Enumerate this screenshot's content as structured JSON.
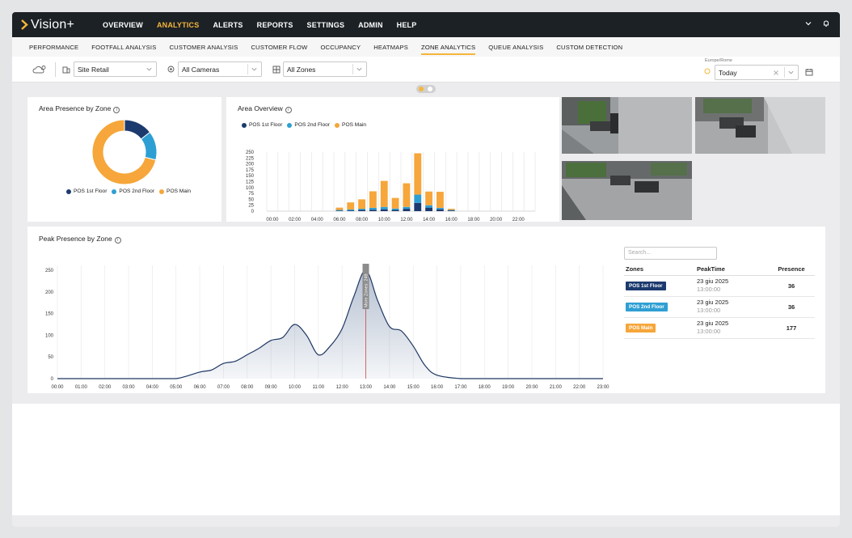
{
  "app": {
    "logo_text": "Vision+"
  },
  "main_nav": [
    {
      "label": "OVERVIEW"
    },
    {
      "label": "ANALYTICS",
      "active": true
    },
    {
      "label": "ALERTS"
    },
    {
      "label": "REPORTS"
    },
    {
      "label": "SETTINGS"
    },
    {
      "label": "ADMIN"
    },
    {
      "label": "HELP"
    }
  ],
  "sub_nav": [
    {
      "label": "PERFORMANCE"
    },
    {
      "label": "FOOTFALL ANALYSIS"
    },
    {
      "label": "CUSTOMER ANALYSIS"
    },
    {
      "label": "CUSTOMER FLOW"
    },
    {
      "label": "OCCUPANCY"
    },
    {
      "label": "HEATMAPS"
    },
    {
      "label": "ZONE ANALYTICS",
      "active": true
    },
    {
      "label": "QUEUE ANALYSIS"
    },
    {
      "label": "CUSTOM DETECTION"
    }
  ],
  "filters": {
    "site": "Site Retail",
    "cameras": "All Cameras",
    "zones": "All Zones",
    "timezone": "Europe/Rome",
    "period": "Today"
  },
  "colors": {
    "accent": "#f5b63b",
    "pos1": "#1c3a6e",
    "pos2": "#2e9fd3",
    "posmain": "#f6a63a"
  },
  "area_presence": {
    "title": "Area Presence by Zone",
    "chart_data": {
      "type": "pie",
      "labels": [
        "POS 1st Floor",
        "POS 2nd Floor",
        "POS Main"
      ],
      "values": [
        36,
        36,
        177
      ]
    }
  },
  "area_overview": {
    "title": "Area Overview",
    "chart_data": {
      "type": "bar",
      "stacked": true,
      "x": [
        "00:00",
        "01:00",
        "02:00",
        "03:00",
        "04:00",
        "05:00",
        "06:00",
        "07:00",
        "08:00",
        "09:00",
        "10:00",
        "11:00",
        "12:00",
        "13:00",
        "14:00",
        "15:00",
        "16:00",
        "17:00",
        "18:00",
        "19:00",
        "20:00",
        "21:00",
        "22:00",
        "23:00"
      ],
      "tick_labels": [
        "00:00",
        "02:00",
        "04:00",
        "06:00",
        "08:00",
        "10:00",
        "12:00",
        "14:00",
        "16:00",
        "18:00",
        "20:00",
        "22:00"
      ],
      "series": [
        {
          "name": "POS 1st Floor",
          "values": [
            0,
            0,
            0,
            0,
            0,
            0,
            2,
            3,
            5,
            6,
            8,
            5,
            10,
            35,
            15,
            8,
            3,
            0,
            0,
            0,
            0,
            0,
            0,
            0
          ]
        },
        {
          "name": "POS 2nd Floor",
          "values": [
            0,
            0,
            0,
            0,
            0,
            0,
            3,
            4,
            5,
            8,
            10,
            6,
            8,
            35,
            10,
            6,
            2,
            0,
            0,
            0,
            0,
            0,
            0,
            0
          ]
        },
        {
          "name": "POS Main",
          "values": [
            0,
            0,
            0,
            0,
            0,
            0,
            10,
            30,
            40,
            70,
            110,
            45,
            100,
            175,
            58,
            68,
            5,
            0,
            0,
            0,
            0,
            0,
            0,
            0
          ]
        }
      ],
      "yticks": [
        0,
        25,
        50,
        75,
        100,
        125,
        150,
        175,
        200,
        225,
        250
      ],
      "ylim": [
        0,
        250
      ]
    }
  },
  "peak_presence": {
    "title": "Peak Presence by Zone",
    "marker_label": "More Zones: 249",
    "chart_data": {
      "type": "area",
      "x": [
        "00:00",
        "01:00",
        "02:00",
        "03:00",
        "04:00",
        "05:00",
        "06:00",
        "06:30",
        "07:00",
        "07:30",
        "08:00",
        "08:30",
        "09:00",
        "09:30",
        "10:00",
        "10:30",
        "11:00",
        "11:30",
        "12:00",
        "12:30",
        "13:00",
        "13:30",
        "14:00",
        "14:30",
        "15:00",
        "15:30",
        "16:00",
        "17:00",
        "18:00",
        "19:00",
        "20:00",
        "21:00",
        "22:00",
        "23:00"
      ],
      "values": [
        0,
        0,
        0,
        0,
        0,
        0,
        15,
        20,
        35,
        40,
        55,
        70,
        88,
        95,
        125,
        100,
        55,
        75,
        115,
        190,
        250,
        180,
        120,
        110,
        75,
        30,
        8,
        0,
        0,
        0,
        0,
        0,
        0,
        0
      ],
      "tick_labels": [
        "00:00",
        "01:00",
        "02:00",
        "03:00",
        "04:00",
        "05:00",
        "06:00",
        "07:00",
        "08:00",
        "09:00",
        "10:00",
        "11:00",
        "12:00",
        "13:00",
        "14:00",
        "15:00",
        "16:00",
        "17:00",
        "18:00",
        "19:00",
        "20:00",
        "21:00",
        "22:00",
        "23:00"
      ],
      "yticks": [
        0,
        50,
        100,
        150,
        200,
        250
      ],
      "ylim": [
        0,
        250
      ],
      "marker_x": "13:00"
    }
  },
  "zones_table": {
    "search_placeholder": "Search...",
    "headers": [
      "Zones",
      "PeakTime",
      "Presence"
    ],
    "rows": [
      {
        "zone": "POS 1st Floor",
        "date": "23 giu 2025",
        "time": "13:00:00",
        "presence": "36",
        "color": "#1c3a6e"
      },
      {
        "zone": "POS 2nd Floor",
        "date": "23 giu 2025",
        "time": "13:00:00",
        "presence": "36",
        "color": "#2e9fd3"
      },
      {
        "zone": "POS Main",
        "date": "23 giu 2025",
        "time": "13:00:00",
        "presence": "177",
        "color": "#f6a63a"
      }
    ]
  }
}
